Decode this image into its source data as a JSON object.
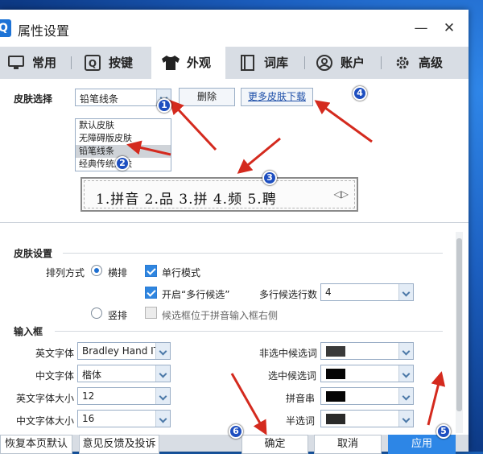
{
  "window": {
    "title": "属性设置",
    "logo": "Q",
    "minimize": "—",
    "close": "✕"
  },
  "tabs": [
    {
      "label": "常用",
      "icon": "monitor-icon"
    },
    {
      "label": "按键",
      "icon": "key-icon"
    },
    {
      "label": "外观",
      "icon": "shirt-icon",
      "active": true
    },
    {
      "label": "词库",
      "icon": "book-icon"
    },
    {
      "label": "账户",
      "icon": "user-icon"
    },
    {
      "label": "高级",
      "icon": "gear-icon"
    }
  ],
  "skin": {
    "label": "皮肤选择",
    "selected": "铅笔线条",
    "delete_label": "删除",
    "more_label": "更多皮肤下载",
    "options": [
      "默认皮肤",
      "无障碍版皮肤",
      "铅笔线条",
      "经典传统皮肤"
    ],
    "preview_text": "1.拼音 2.品 3.拼 4.频 5.聘",
    "preview_nav": "◁▷"
  },
  "skin_settings": {
    "heading": "皮肤设置",
    "arrange_label": "排列方式",
    "horizontal": "横排",
    "vertical": "竖排",
    "single_line": "单行模式",
    "multi_line": "开启“多行候选”",
    "multi_count_label": "多行候选行数",
    "multi_count_value": "4",
    "candidate_right": "候选框位于拼音输入框右侧"
  },
  "input_box": {
    "heading": "输入框",
    "en_font_label": "英文字体",
    "en_font_value": "Bradley Hand ITC",
    "cn_font_label": "中文字体",
    "cn_font_value": "楷体",
    "en_size_label": "英文字体大小",
    "en_size_value": "12",
    "cn_size_label": "中文字体大小",
    "cn_size_value": "16",
    "unselected_label": "非选中候选词",
    "selected_label": "选中候选词",
    "pinyin_label": "拼音串",
    "half_label": "半选词",
    "colors": {
      "unselected": "#3a3a3a",
      "selected": "#050505",
      "pinyin": "#050505",
      "half": "#2a2a2a"
    }
  },
  "footer": {
    "restore": "恢复本页默认",
    "feedback": "意见反馈及投诉",
    "ok": "确定",
    "cancel": "取消",
    "apply": "应用"
  },
  "annotations": [
    "1",
    "2",
    "3",
    "4",
    "5",
    "6"
  ],
  "accent_color": "#2d86e6"
}
